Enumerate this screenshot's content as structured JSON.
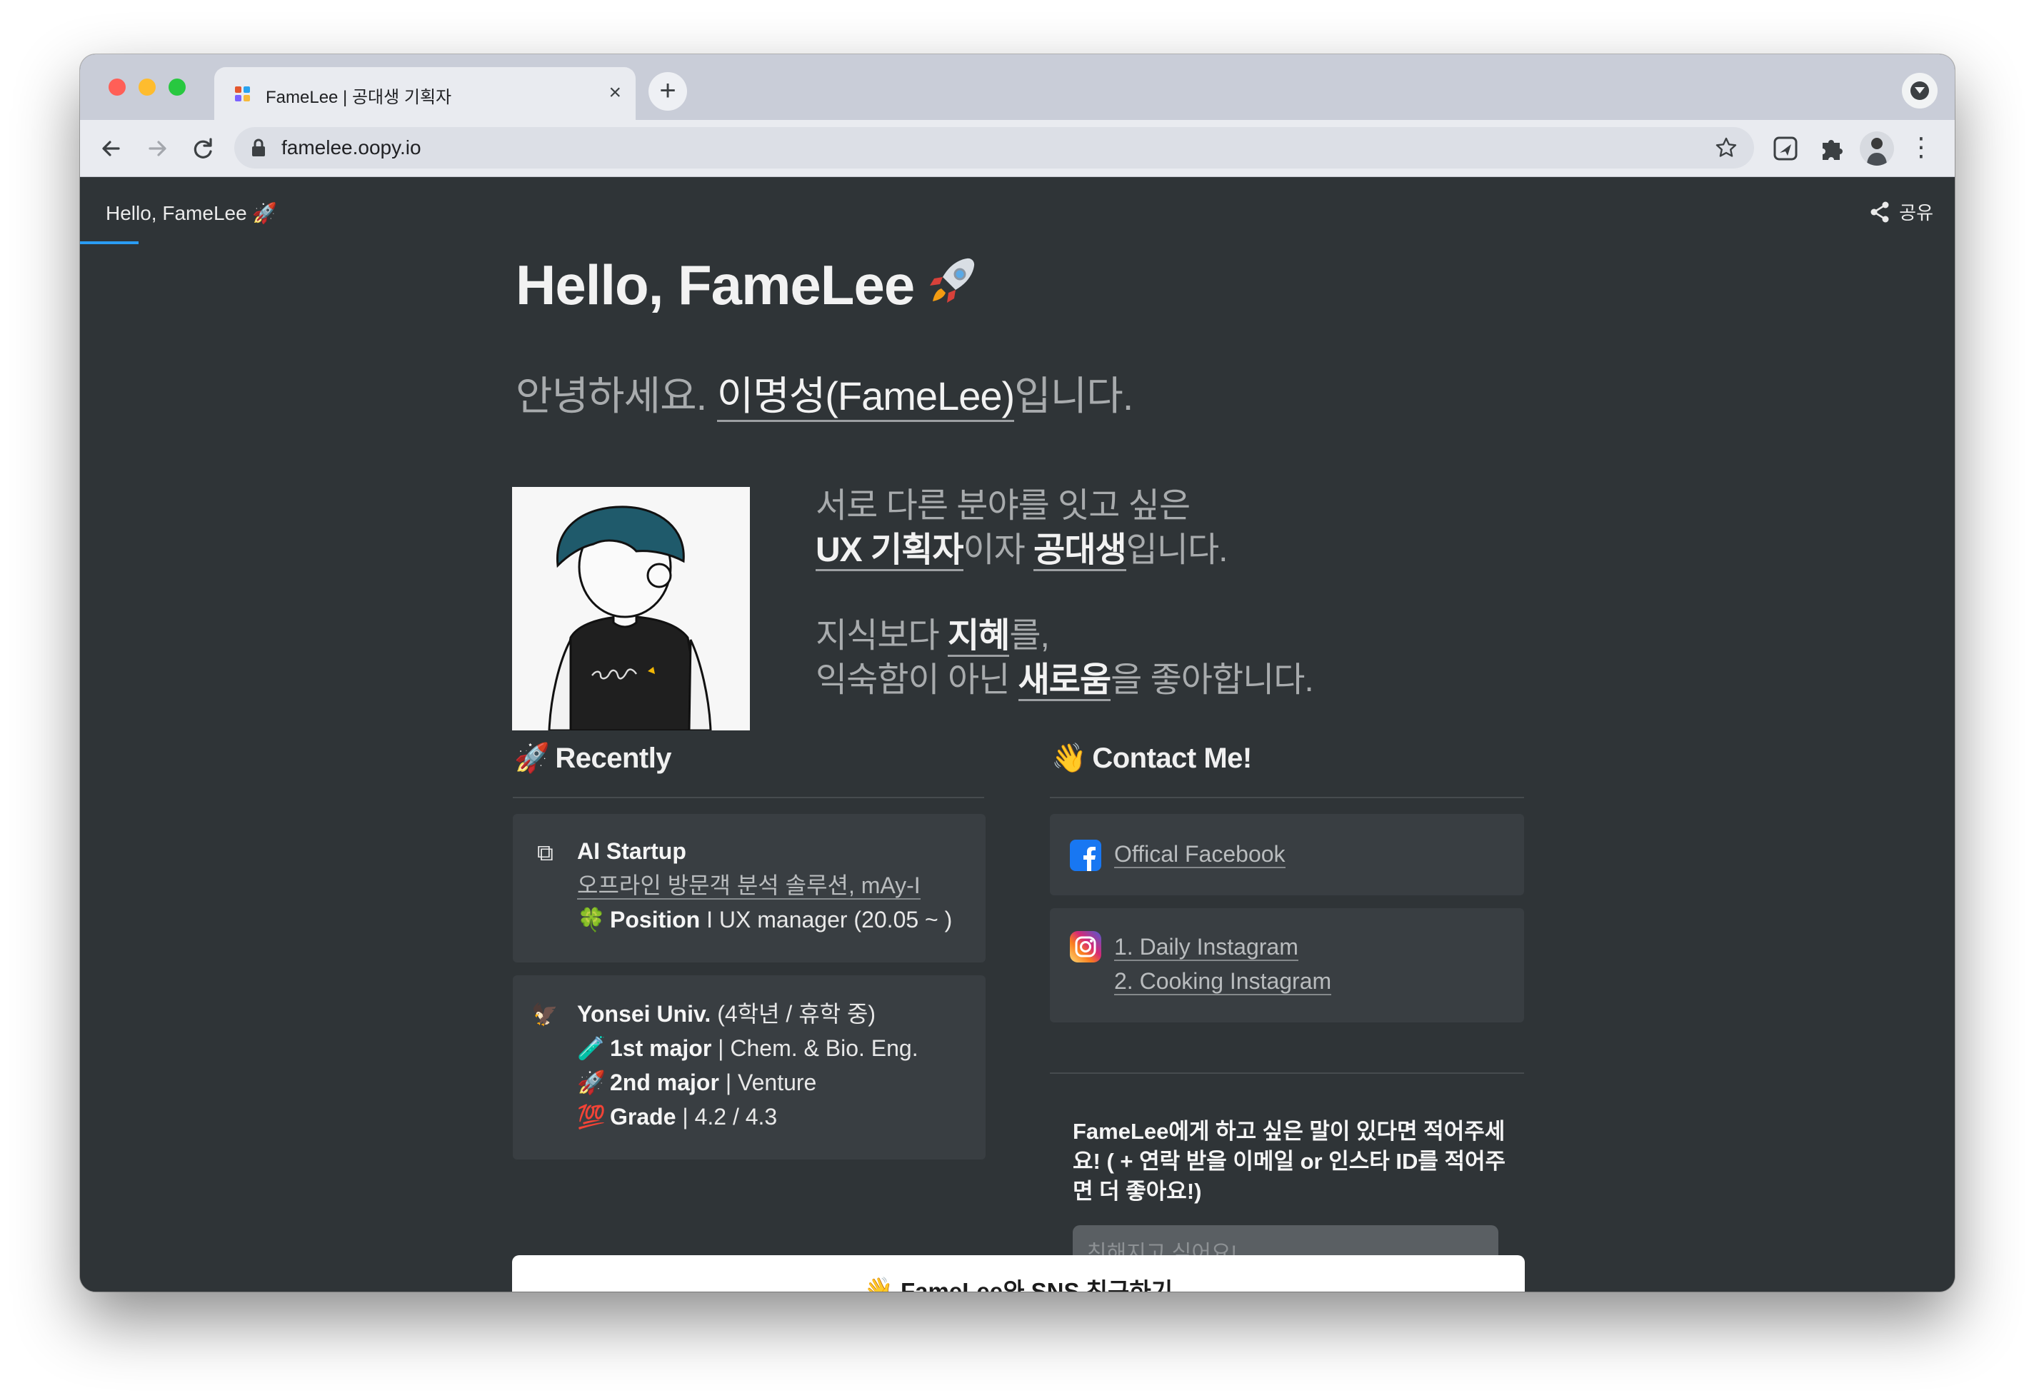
{
  "browser": {
    "tab_title": "FameLee | 공대생 기획자",
    "tab_close": "×",
    "new_tab": "+",
    "url": "famelee.oopy.io"
  },
  "page": {
    "topbar_title": "Hello, FameLee 🚀",
    "share_label": "공유",
    "heading": "Hello, FameLee",
    "greeting_prefix": "안녕하세요. ",
    "greeting_name": "이명성(FameLee)",
    "greeting_suffix": "입니다.",
    "intro": {
      "line1": "서로 다른 분야를 잇고 싶은",
      "line2_em1": "UX 기획자",
      "line2_mid": "이자 ",
      "line2_em2": "공대생",
      "line2_end": "입니다.",
      "line3_pre": "지식보다 ",
      "line3_em": "지혜",
      "line3_end": "를,",
      "line4_pre": "익숙함이 아닌 ",
      "line4_em": "새로움",
      "line4_end": "을 좋아합니다."
    }
  },
  "recently": {
    "emoji": "🚀",
    "title": "Recently",
    "startup": {
      "icon": "⧉",
      "name": "AI Startup",
      "link": "오프라인 방문객 분석 솔루션, mAy-I",
      "pos_emoji": "🍀",
      "pos_label": "Position",
      "pos_value": " I UX manager (20.05 ~ )"
    },
    "univ": {
      "icon": "🦅",
      "name": "Yonsei Univ.",
      "name_suffix": " (4학년 / 휴학 중)",
      "rows": [
        {
          "emoji": "🧪",
          "label": "1st major",
          "value": " | Chem. & Bio. Eng."
        },
        {
          "emoji": "🚀",
          "label": "2nd major",
          "value": " | Venture"
        },
        {
          "emoji": "💯",
          "label": "Grade",
          "value": " | 4.2 / 4.3"
        }
      ]
    }
  },
  "contact": {
    "emoji": "👋",
    "title": "Contact Me!",
    "facebook": "Offical Facebook",
    "instagram_1": "1. Daily Instagram",
    "instagram_2": "2. Cooking Instagram",
    "form_question": "FameLee에게 하고 싶은 말이 있다면 적어주세요! ( + 연락 받을 이메일 or 인스타 ID를 적어주면 더 좋아요!)",
    "form_placeholder": "친해지고 싶어요!"
  },
  "cta": {
    "emoji": "👋",
    "label": "FameLee와 SNS 친구하기"
  },
  "colors": {
    "page_bg": "#2f3437",
    "card_bg": "#393e42",
    "accent_underline": "#2a9df4",
    "facebook": "#1877f2"
  }
}
